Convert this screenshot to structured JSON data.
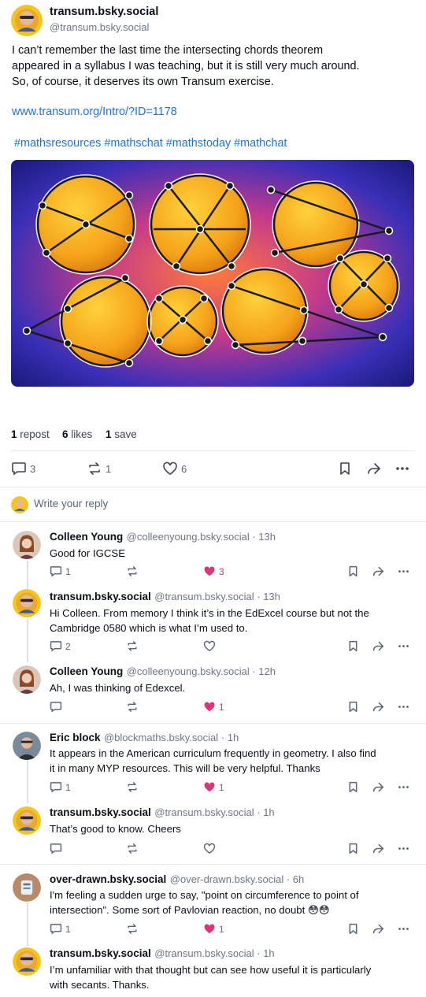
{
  "post": {
    "display_name": "transum.bsky.social",
    "handle": "@transum.bsky.social",
    "text_line1": "I can’t remember the last time the intersecting chords theorem",
    "text_line2": "appeared in a syllabus I was teaching, but it is still very much around.",
    "text_line3": "So, of course, it deserves its own Transum exercise.",
    "link": "www.transum.org/Intro/?ID=1178",
    "hashtags": "#mathsresources #mathschat #mathstoday #mathchat",
    "image_icon": "intersecting-chords-circles-illustration"
  },
  "stats": {
    "reposts_count": "1",
    "reposts_label": "repost",
    "likes_count": "6",
    "likes_label": "likes",
    "saves_count": "1",
    "saves_label": "save"
  },
  "actions": {
    "reply_count": "3",
    "repost_count": "1",
    "like_count": "6"
  },
  "composer": {
    "placeholder": "Write your reply"
  },
  "replies": [
    {
      "name": "Colleen Young",
      "meta": "@colleenyoung.bsky.social · 13h",
      "line1": "Good for IGCSE",
      "line2": "",
      "reply_count": "1",
      "like_count": "3"
    },
    {
      "name": "transum.bsky.social",
      "meta": "@transum.bsky.social · 13h",
      "line1": "Hi Colleen. From memory I think it’s in the EdExcel course but not the",
      "line2": "Cambridge 0580 which is what I’m used to.",
      "reply_count": "2",
      "like_count": ""
    },
    {
      "name": "Colleen Young",
      "meta": "@colleenyoung.bsky.social · 12h",
      "line1": "Ah, I was thinking of Edexcel.",
      "line2": "",
      "reply_count": "",
      "like_count": "1"
    },
    {
      "name": "Eric block",
      "meta": "@blockmaths.bsky.social · 1h",
      "line1": "It appears in the American curriculum frequently in geometry. I also find",
      "line2": "it in many MYP resources. This will be very helpful. Thanks",
      "reply_count": "1",
      "like_count": "1"
    },
    {
      "name": "transum.bsky.social",
      "meta": "@transum.bsky.social · 1h",
      "line1": "That’s good to know. Cheers",
      "line2": "",
      "reply_count": "",
      "like_count": ""
    },
    {
      "name": "over-drawn.bsky.social",
      "meta": "@over-drawn.bsky.social · 6h",
      "line1": "I'm feeling a sudden urge to say, \"point on circumference to point of",
      "line2": "intersection\". Some sort of Pavlovian reaction, no doubt 😳😳",
      "reply_count": "1",
      "like_count": "1"
    },
    {
      "name": "transum.bsky.social",
      "meta": "@transum.bsky.social · 1h",
      "line1": "I’m unfamiliar with that thought but can see how useful it is particularly",
      "line2": "with secants. Thanks.",
      "reply_count": "",
      "like_count": ""
    }
  ],
  "colors": {
    "link": "#1f73d6",
    "like_pink": "#e0327b",
    "muted": "#6b7686"
  }
}
